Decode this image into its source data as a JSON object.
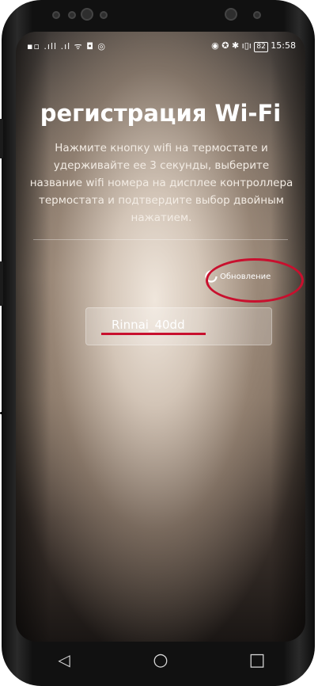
{
  "status_bar": {
    "left_icons": "▪▫ .ıll .ıl ᯤ ◘ ◎",
    "right_icons": "◉ ✪ ✱ ı▯ı",
    "battery": "82",
    "time": "15:58"
  },
  "page": {
    "title": "регистрация Wi-Fi",
    "description": "Нажмите кнопку wifi на термостате и удерживайте ее 3 секунды, выберите название wifi номера на дисплее контроллера термостата и подтвердите выбор двойным нажатием."
  },
  "refresh": {
    "label": "Обновление",
    "icon": "refresh-icon"
  },
  "networks": [
    {
      "name": "Rinnai_40dd"
    }
  ],
  "nav_bar": {
    "back": "◁",
    "home": "○",
    "recents": "□"
  },
  "colors": {
    "annotation": "#c8102e",
    "text": "#ffffff"
  }
}
